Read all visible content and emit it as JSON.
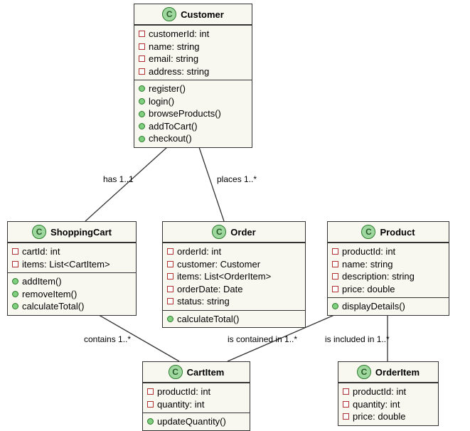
{
  "classes": {
    "customer": {
      "name": "Customer",
      "attrs": [
        "customerId: int",
        "name: string",
        "email: string",
        "address: string"
      ],
      "ops": [
        "register()",
        "login()",
        "browseProducts()",
        "addToCart()",
        "checkout()"
      ]
    },
    "shoppingCart": {
      "name": "ShoppingCart",
      "attrs": [
        "cartId: int",
        "items: List<CartItem>"
      ],
      "ops": [
        "addItem()",
        "removeItem()",
        "calculateTotal()"
      ]
    },
    "order": {
      "name": "Order",
      "attrs": [
        "orderId: int",
        "customer: Customer",
        "items: List<OrderItem>",
        "orderDate: Date",
        "status: string"
      ],
      "ops": [
        "calculateTotal()"
      ]
    },
    "product": {
      "name": "Product",
      "attrs": [
        "productId: int",
        "name: string",
        "description: string",
        "price: double"
      ],
      "ops": [
        "displayDetails()"
      ]
    },
    "cartItem": {
      "name": "CartItem",
      "attrs": [
        "productId: int",
        "quantity: int"
      ],
      "ops": [
        "updateQuantity()"
      ]
    },
    "orderItem": {
      "name": "OrderItem",
      "attrs": [
        "productId: int",
        "quantity: int",
        "price: double"
      ],
      "ops": []
    }
  },
  "edges": {
    "has": "has 1..1",
    "places": "places 1..*",
    "contains": "contains 1..*",
    "isContainedIn": "is contained in 1..*",
    "isIncludedIn": "is included in 1..*"
  }
}
